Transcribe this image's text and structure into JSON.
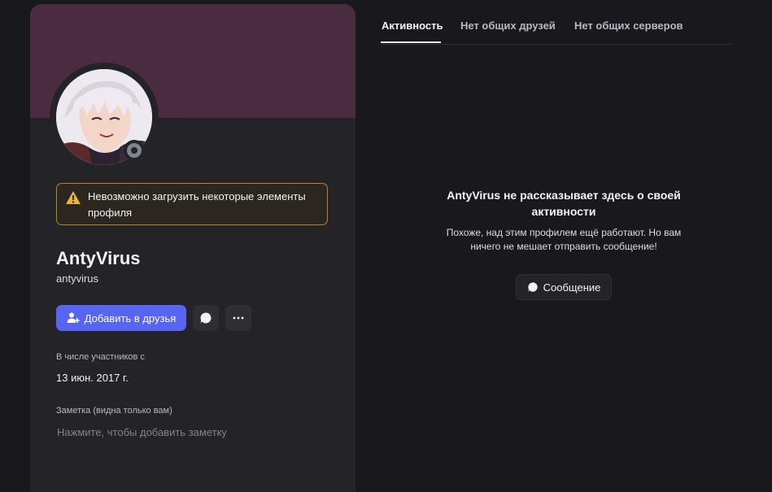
{
  "profile": {
    "warning_text": "Невозможно загрузить некоторые элементы профиля",
    "display_name": "AntyVirus",
    "username": "antyvirus",
    "add_friend_label": "Добавить в друзья",
    "member_since_label": "В числе участников с",
    "member_since_date": "13 июн. 2017 г.",
    "note_label": "Заметка (видна только вам)",
    "note_placeholder": "Нажмите, чтобы добавить заметку",
    "status": "offline"
  },
  "tabs": [
    {
      "label": "Активность"
    },
    {
      "label": "Нет общих друзей"
    },
    {
      "label": "Нет общих серверов"
    }
  ],
  "activity": {
    "title": "AntyVirus не рассказывает здесь о своей активности",
    "description": "Похоже, над этим профилем ещё работают. Но вам ничего не мешает отправить сообщение!",
    "message_button": "Сообщение"
  },
  "colors": {
    "banner": "#4a2b3f",
    "accent": "#5865f2",
    "warning_border": "#b98427"
  }
}
